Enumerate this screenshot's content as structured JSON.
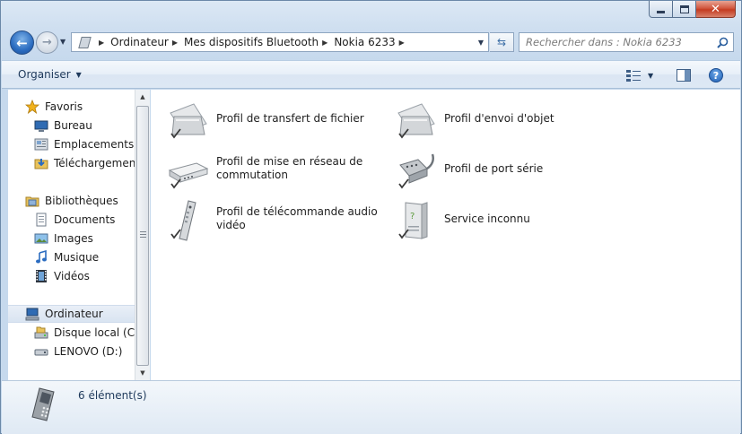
{
  "window": {
    "caption": {
      "minimize": "minimize",
      "maximize": "maximize",
      "close": "close"
    }
  },
  "nav": {
    "breadcrumb": [
      "Ordinateur",
      "Mes dispositifs Bluetooth",
      "Nokia 6233"
    ],
    "search_placeholder": "Rechercher dans : Nokia 6233"
  },
  "toolbar": {
    "organiser_label": "Organiser"
  },
  "sidebar": {
    "favoris": {
      "label": "Favoris",
      "items": [
        {
          "label": "Bureau",
          "icon": "desktop-icon"
        },
        {
          "label": "Emplacements ré",
          "icon": "recent-places-icon"
        },
        {
          "label": "Téléchargements",
          "icon": "downloads-icon"
        }
      ]
    },
    "bibliotheques": {
      "label": "Bibliothèques",
      "items": [
        {
          "label": "Documents",
          "icon": "documents-icon"
        },
        {
          "label": "Images",
          "icon": "images-icon"
        },
        {
          "label": "Musique",
          "icon": "music-icon"
        },
        {
          "label": "Vidéos",
          "icon": "videos-icon"
        }
      ]
    },
    "ordinateur": {
      "label": "Ordinateur",
      "items": [
        {
          "label": "Disque local (C:)",
          "icon": "local-disk-icon"
        },
        {
          "label": "LENOVO (D:)",
          "icon": "drive-icon"
        }
      ]
    }
  },
  "services": [
    {
      "label": "Profil de transfert de fichier",
      "icon": "folder-icon"
    },
    {
      "label": "Profil d'envoi d'objet",
      "icon": "folder-icon"
    },
    {
      "label": "Profil de mise en réseau de commutation",
      "icon": "modem-icon"
    },
    {
      "label": "Profil de port série",
      "icon": "serial-port-icon"
    },
    {
      "label": "Profil de télécommande audio vidéo",
      "icon": "remote-control-icon"
    },
    {
      "label": "Service inconnu",
      "icon": "unknown-service-icon"
    }
  ],
  "status": {
    "count_text": "6 élément(s)"
  }
}
